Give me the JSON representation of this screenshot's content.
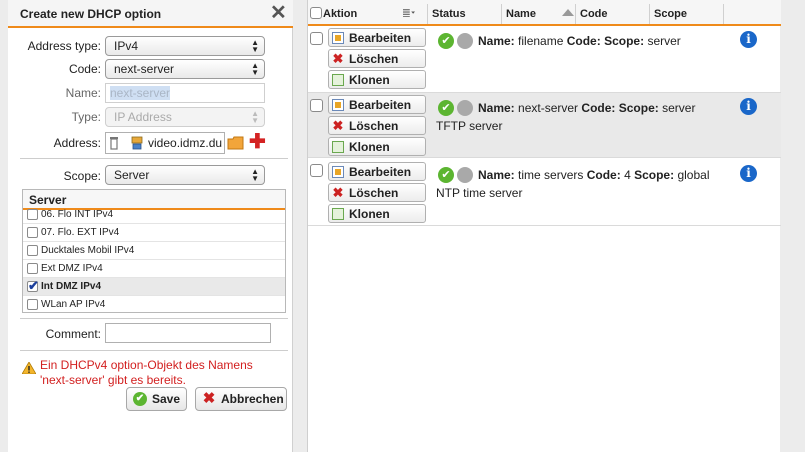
{
  "dialog": {
    "title": "Create new DHCP option",
    "fields": {
      "address_type_label": "Address type:",
      "address_type_value": "IPv4",
      "code_label": "Code:",
      "code_value": "next-server",
      "name_label": "Name:",
      "name_value": "next-server",
      "type_label": "Type:",
      "type_placeholder": "IP Address",
      "address_label": "Address:",
      "address_value": "video.idmz.du",
      "scope_label": "Scope:",
      "scope_value": "Server"
    },
    "server_list": {
      "header": "Server",
      "items": [
        {
          "label": "06. Flo INT IPv4",
          "checked": false
        },
        {
          "label": "07. Flo. EXT IPv4",
          "checked": false
        },
        {
          "label": "Ducktales Mobil IPv4",
          "checked": false
        },
        {
          "label": "Ext DMZ IPv4",
          "checked": false
        },
        {
          "label": "Int DMZ IPv4",
          "checked": true
        },
        {
          "label": "WLan AP IPv4",
          "checked": false
        }
      ]
    },
    "comment_label": "Comment:",
    "warning": "Ein DHCPv4 option-Objekt des Namens 'next-server' gibt es bereits.",
    "save_label": "Save",
    "cancel_label": "Abbrechen"
  },
  "table": {
    "columns": [
      "Aktion",
      "Status",
      "Name",
      "Code",
      "Scope"
    ],
    "action_labels": {
      "edit": "Bearbeiten",
      "delete": "Löschen",
      "clone": "Klonen"
    },
    "field_labels": {
      "name": "Name:",
      "code": "Code:",
      "scope": "Scope:"
    },
    "rows": [
      {
        "name": "filename",
        "code": "",
        "scope": "server",
        "comment": ""
      },
      {
        "name": "next-server",
        "code": "",
        "scope": "server",
        "comment": "TFTP server"
      },
      {
        "name": "time servers",
        "code": "4",
        "scope": "global",
        "comment": "NTP time server"
      }
    ]
  },
  "colors": {
    "accent": "#ef8a1a",
    "error": "#d21f1f",
    "ok": "#5cb531",
    "info": "#1a67c9"
  },
  "icons": [
    "close-icon",
    "trash-icon",
    "network-object-icon",
    "folder-icon",
    "plus-icon",
    "warning-icon",
    "check-circle-icon",
    "x-icon",
    "edit-icon",
    "clone-icon",
    "status-enabled-icon",
    "status-disabled-icon",
    "info-icon",
    "column-menu-icon",
    "sort-ascending-icon"
  ]
}
